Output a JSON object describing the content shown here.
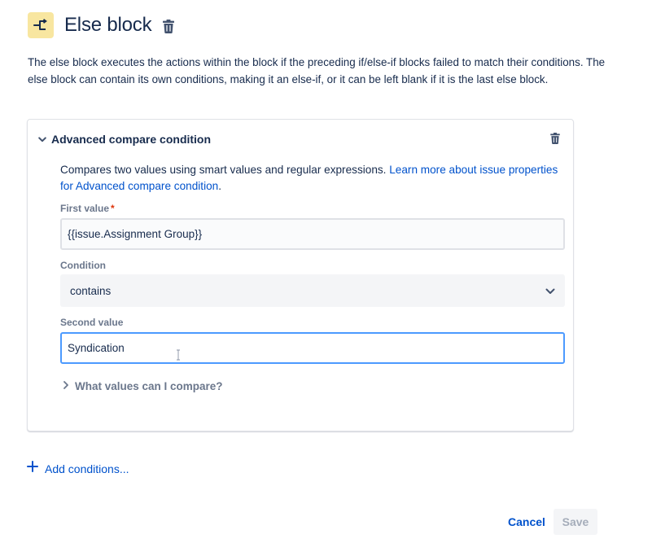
{
  "header": {
    "title": "Else block",
    "icon": "branch-icon",
    "icon_bg": "#f8e6a0",
    "trash_icon": "trash-icon"
  },
  "description": "The else block executes the actions within the block if the preceding if/else-if blocks failed to match their conditions. The else block can contain its own conditions, making it an else-if, or it can be left blank if it is the last else block.",
  "condition_card": {
    "title": "Advanced compare condition",
    "expanded": true,
    "description_text": "Compares two values using smart values and regular expressions. ",
    "description_link": "Learn more about issue properties for Advanced compare condition",
    "description_end": ".",
    "first_value": {
      "label": "First value",
      "required_marker": "*",
      "value": "{{issue.Assignment Group}}"
    },
    "condition": {
      "label": "Condition",
      "selected": "contains"
    },
    "second_value": {
      "label": "Second value",
      "value": "Syndication"
    },
    "help_expander": "What values can I compare?"
  },
  "add_conditions_label": "Add conditions...",
  "footer": {
    "cancel_label": "Cancel",
    "save_label": "Save"
  },
  "colors": {
    "link": "#0052cc",
    "text": "#172b4d",
    "subtle": "#6b778c",
    "focus_border": "#4c9aff",
    "required": "#de350b"
  }
}
